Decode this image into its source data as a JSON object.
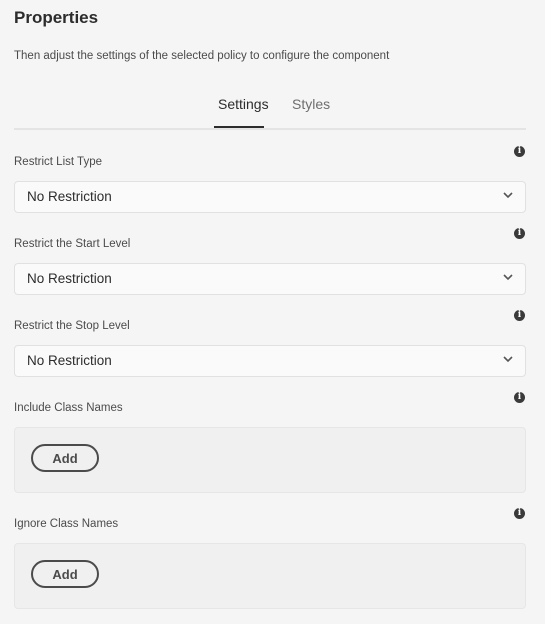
{
  "header": {
    "title": "Properties",
    "subtitle": "Then adjust the settings of the selected policy to configure the component"
  },
  "tabs": [
    {
      "label": "Settings",
      "active": true
    },
    {
      "label": "Styles",
      "active": false
    }
  ],
  "fields": {
    "list_type": {
      "label": "Restrict List Type",
      "value": "No Restriction",
      "info_icon": "info-icon"
    },
    "start_level": {
      "label": "Restrict the Start Level",
      "value": "No Restriction",
      "info_icon": "info-icon"
    },
    "stop_level": {
      "label": "Restrict the Stop Level",
      "value": "No Restriction",
      "info_icon": "info-icon"
    },
    "include_class": {
      "label": "Include Class Names",
      "button": "Add",
      "info_icon": "info-icon"
    },
    "ignore_class": {
      "label": "Ignore Class Names",
      "button": "Add",
      "info_icon": "info-icon"
    }
  },
  "info_glyph": "i"
}
